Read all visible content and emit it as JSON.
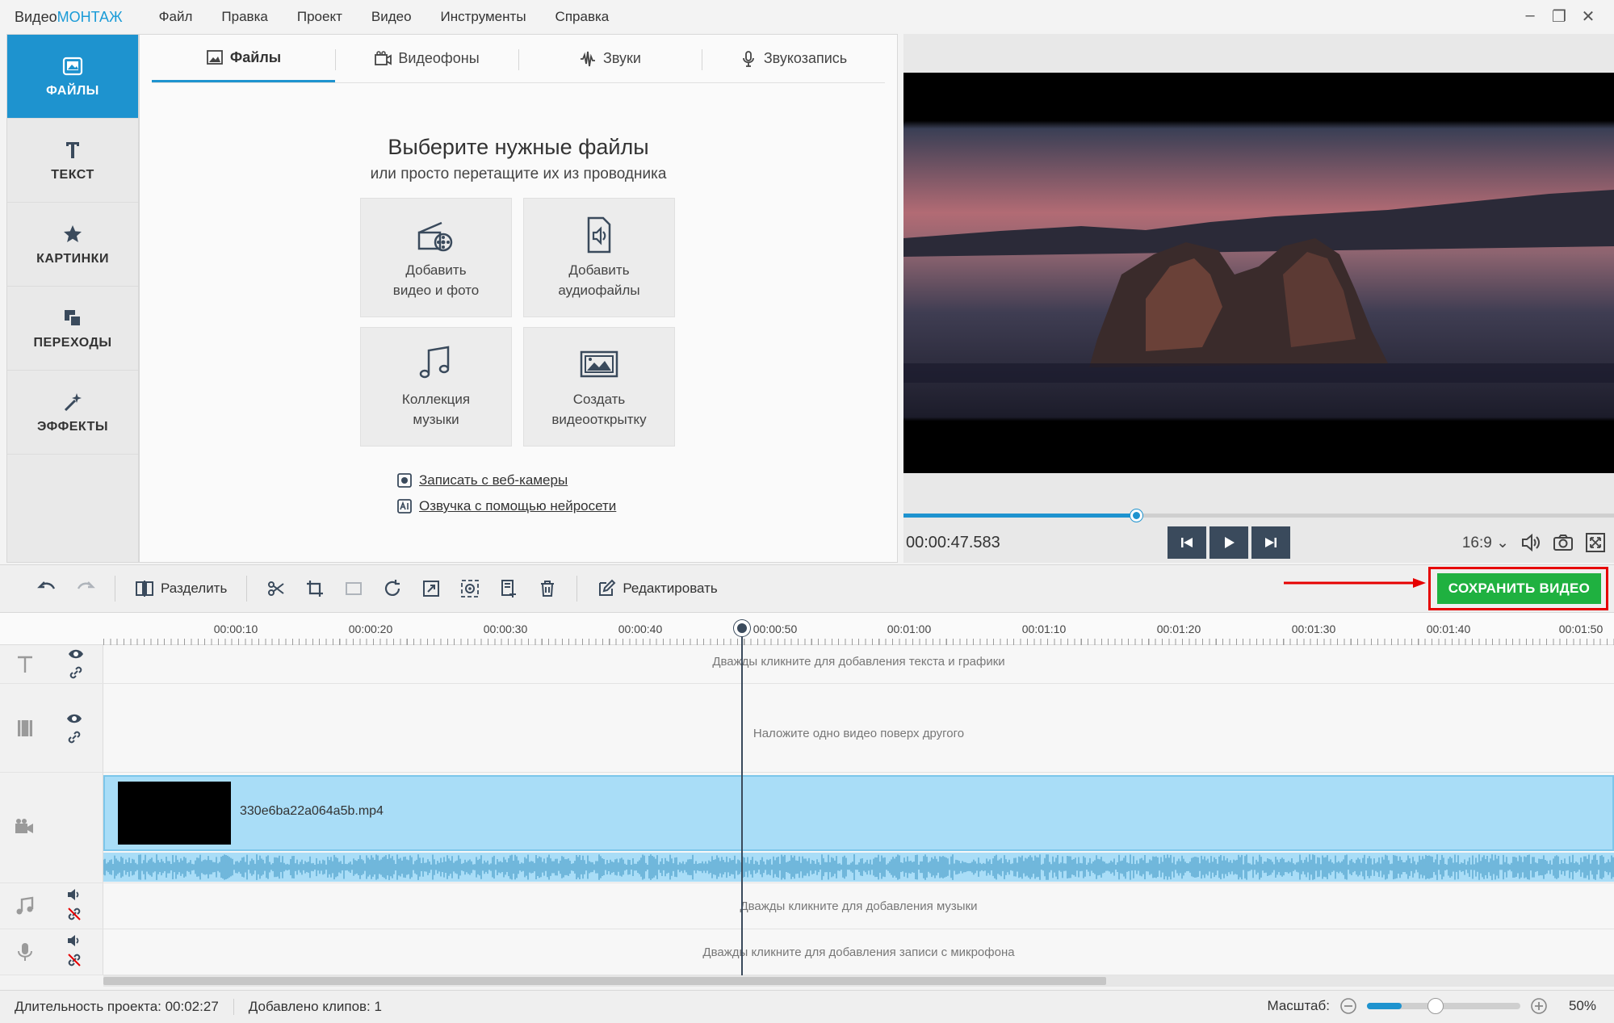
{
  "app": {
    "logo_prefix": "Видео",
    "logo_accent": "МОНТАЖ",
    "accent_color": "#1e93cf",
    "save_color": "#1fb140"
  },
  "menu": [
    "Файл",
    "Правка",
    "Проект",
    "Видео",
    "Инструменты",
    "Справка"
  ],
  "sidebar": {
    "items": [
      {
        "label": "ФАЙЛЫ",
        "icon": "image-icon",
        "active": true
      },
      {
        "label": "ТЕКСТ",
        "icon": "text-icon",
        "active": false
      },
      {
        "label": "КАРТИНКИ",
        "icon": "star-icon",
        "active": false
      },
      {
        "label": "ПЕРЕХОДЫ",
        "icon": "transitions-icon",
        "active": false
      },
      {
        "label": "ЭФФЕКТЫ",
        "icon": "magic-wand-icon",
        "active": false
      }
    ]
  },
  "files_panel": {
    "tabs": [
      {
        "label": "Файлы",
        "icon": "picture-icon",
        "active": true
      },
      {
        "label": "Видеофоны",
        "icon": "film-icon",
        "active": false
      },
      {
        "label": "Звуки",
        "icon": "waveform-icon",
        "active": false
      },
      {
        "label": "Звукозапись",
        "icon": "microphone-icon",
        "active": false
      }
    ],
    "headline": "Выберите нужные файлы",
    "subline": "или просто перетащите их из проводника",
    "tiles": [
      {
        "label": "Добавить\nвидео и фото",
        "icon": "film-reel-icon"
      },
      {
        "label": "Добавить\nаудиофайлы",
        "icon": "audio-file-icon"
      },
      {
        "label": "Коллекция\nмузыки",
        "icon": "music-notes-icon"
      },
      {
        "label": "Создать\nвидеооткрытку",
        "icon": "postcard-icon"
      }
    ],
    "links": [
      {
        "label": "Записать с веб-камеры",
        "icon": "webcam-icon"
      },
      {
        "label": "Озвучка с помощью нейросети",
        "icon": "ai-voice-icon"
      }
    ]
  },
  "preview": {
    "timecode": "00:00:47.583",
    "progress": 0.327,
    "aspect_ratio": "16:9"
  },
  "toolbar": {
    "split_label": "Разделить",
    "edit_label": "Редактировать",
    "save_label": "СОХРАНИТЬ ВИДЕО"
  },
  "timeline": {
    "ruler_labels": [
      "00:00:10",
      "00:00:20",
      "00:00:30",
      "00:00:40",
      "00:00:50",
      "00:01:00",
      "00:01:10",
      "00:01:20",
      "00:01:30",
      "00:01:40",
      "00:01:50"
    ],
    "text_track_hint": "Дважды кликните для добавления текста и графики",
    "overlay_track_hint": "Наложите одно видео поверх другого",
    "clip_name": "330e6ba22a064a5b.mp4",
    "music_track_hint": "Дважды кликните для добавления музыки",
    "mic_track_hint": "Дважды кликните для добавления записи с микрофона",
    "playhead_time": 47.583
  },
  "status": {
    "duration": "Длительность проекта:  00:02:27",
    "clips": "Добавлено клипов: 1",
    "zoom_label": "Масштаб:",
    "zoom_value": "50%",
    "zoom_level": 0.5
  }
}
